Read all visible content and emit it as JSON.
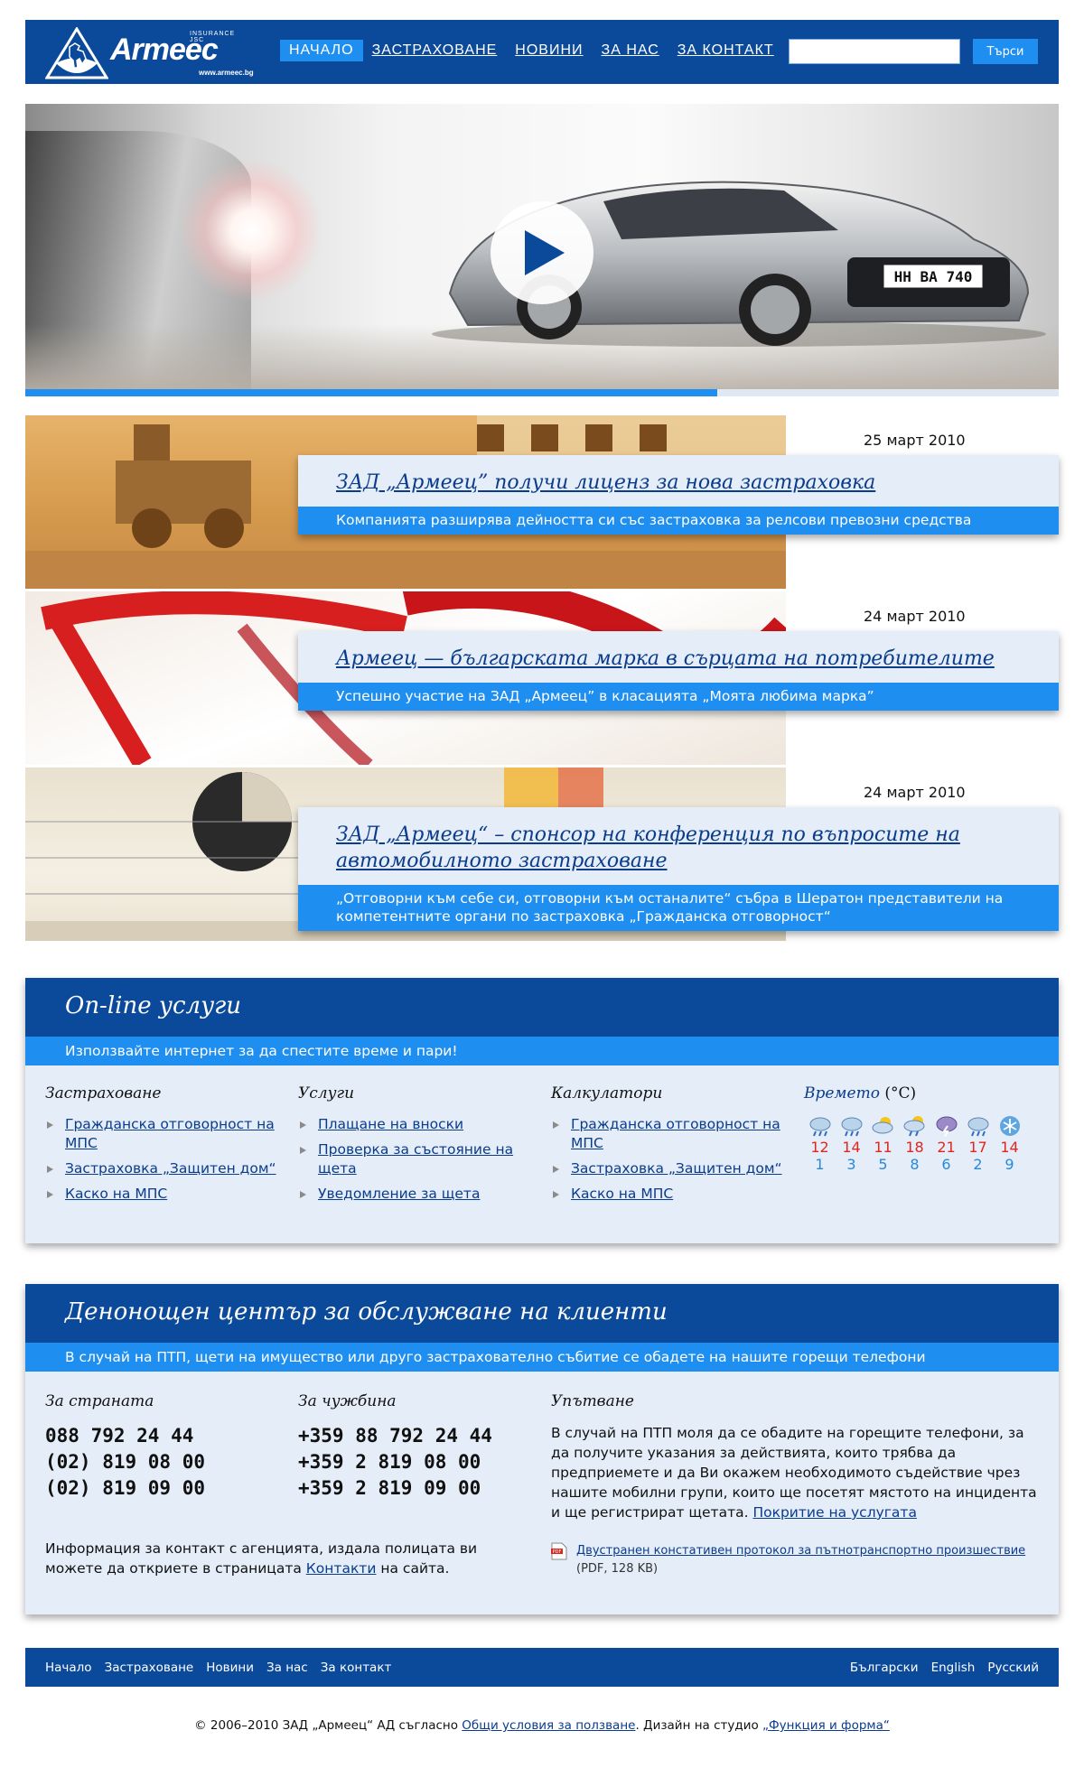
{
  "header": {
    "brand": "Armeec",
    "brand_tag": "INSURANCE JSC",
    "brand_url": "www.armeec.bg",
    "nav": [
      "НАЧАЛО",
      "ЗАСТРАХОВАНЕ",
      "НОВИНИ",
      "ЗА НАС",
      "ЗА КОНТАКТ"
    ],
    "search_placeholder": "",
    "search_button": "Търси"
  },
  "hero": {
    "plate": "HH BA 740",
    "progress": 0.67
  },
  "news": [
    {
      "date": "25 март 2010",
      "title": "ЗАД „Армеец” получи лиценз за нова застраховка",
      "summary": "Компанията разширява дейността си със застраховка за релсови превозни средства"
    },
    {
      "date": "24 март 2010",
      "title": "Армеец — българската марка в сърцата на потребителите",
      "summary": "Успешно участие на ЗАД „Армеец” в класацията „Моята любима марка”"
    },
    {
      "date": "24 март 2010",
      "title": "ЗАД „Армеец“ – спонсор на конференция по въпросите на автомобилното застраховане",
      "summary": "„Отговорни към себе си, отговорни към останалите“ събра в Шератон представители на компетентните органи по застраховка „Гражданска отговорност“"
    }
  ],
  "online": {
    "title": "On-line услуги",
    "subtitle": "Използвайте интернет за да спестите време и пари!",
    "columns": [
      {
        "title": "Застраховане",
        "links": [
          "Гражданска отговорност на МПС",
          "Застраховка „Защитен дом“",
          "Каско на МПС"
        ]
      },
      {
        "title": "Услуги",
        "links": [
          "Плащане на вноски",
          "Проверка за състояние на щета",
          "Уведомление за щета"
        ]
      },
      {
        "title": "Калкулатори",
        "links": [
          "Гражданска отговорност на МПС",
          "Застраховка „Защитен дом“",
          "Каско на МПС"
        ]
      }
    ],
    "weather": {
      "title_link": "Времето",
      "title_unit": "(°C)",
      "days": [
        {
          "icon": "rain-cloud-icon",
          "max": "12",
          "min": "1"
        },
        {
          "icon": "rain-cloud-icon",
          "max": "14",
          "min": "3"
        },
        {
          "icon": "sun-cloud-icon",
          "max": "11",
          "min": "5"
        },
        {
          "icon": "sun-rain-icon",
          "max": "18",
          "min": "8"
        },
        {
          "icon": "storm-cloud-icon",
          "max": "21",
          "min": "6"
        },
        {
          "icon": "rain-cloud-icon",
          "max": "17",
          "min": "2"
        },
        {
          "icon": "snowflake-icon",
          "max": "14",
          "min": "9"
        }
      ]
    }
  },
  "support": {
    "title": "Денонощен център за обслужване на клиенти",
    "subtitle": "В случай на ПТП, щети на имущество или друго застрахователно събитие се обадете на нашите горещи телефони",
    "domestic": {
      "title": "За страната",
      "phones": [
        "088 792 24 44",
        "(02) 819 08 00",
        "(02) 819 09 00"
      ]
    },
    "abroad": {
      "title": "За чужбина",
      "phones": [
        "+359 88 792 24 44",
        "+359 2 819 08 00",
        "+359 2 819 09 00"
      ]
    },
    "guide": {
      "title": "Упътване",
      "text": "В случай на ПТП моля да се обадите на горещите телефони, за да получите указания за действията, които трябва да предприемете и да Ви окажем необходимото съдействие чрез нашите мобилни групи, които ще посетят мястото на инцидента и ще регистрират щетата.",
      "link": "Покритие на услугата"
    },
    "contact_before": "Информация за контакт с агенцията, издала полицата ви можете да откриете в страницата",
    "contact_link": "Контакти",
    "contact_after": "на сайта.",
    "pdf_link": "Двустранен констативен протокол за пътнотранспортно произшествие",
    "pdf_meta": "(PDF, 128 KB)"
  },
  "footer": {
    "nav": [
      "Начало",
      "Застраховане",
      "Новини",
      "За нас",
      "За контакт"
    ],
    "languages": [
      "Български",
      "English",
      "Русский"
    ],
    "copyright_before": "© 2006–2010 ЗАД „Армеец“ АД съгласно",
    "terms_link": "Общи условия за ползване",
    "design_text": ". Дизайн на студио",
    "studio_link": "„Функция и форма“"
  },
  "colors": {
    "dark_blue": "#0b4a9a",
    "accent_blue": "#1e8ef0",
    "panel_bg": "#e4edf8",
    "temp_max": "#e0261e",
    "temp_min": "#2889d8"
  }
}
